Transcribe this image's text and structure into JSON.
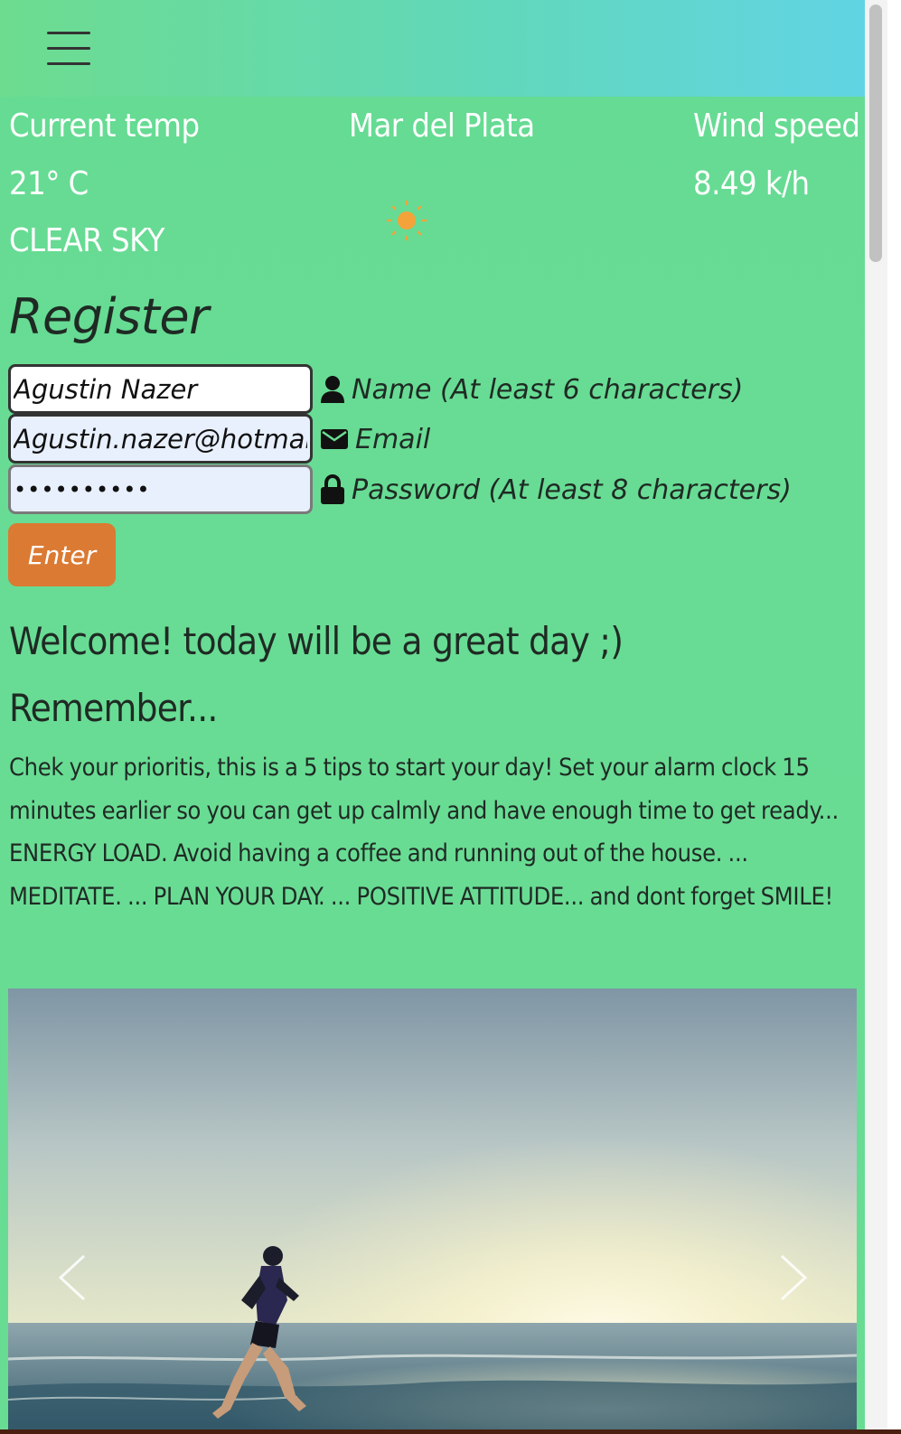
{
  "header": {
    "menu_icon": "hamburger-menu-icon"
  },
  "weather": {
    "current_temp_label": "Current temp",
    "temperature": "21° C",
    "condition": "CLEAR SKY",
    "city": "Mar del Plata",
    "weather_icon": "sun-icon",
    "wind_label": "Wind speed",
    "wind_value": "8.49 k/h"
  },
  "register": {
    "title": "Register",
    "name_value": "Agustin Nazer",
    "name_label": "Name (At least 6 characters)",
    "email_value": "Agustin.nazer@hotmail.com",
    "email_label": "Email",
    "password_value": "••••••••••",
    "password_label": "Password (At least 8 characters)",
    "enter_label": "Enter"
  },
  "content": {
    "welcome": "Welcome! today will be a great day ;)",
    "remember": "Remember...",
    "tips": "Chek your prioritis, this is a 5 tips to start your day! Set your alarm clock 15 minutes earlier so you can get up calmly and have enough time to get ready... ENERGY LOAD. Avoid having a coffee and running out of the house. ... MEDITATE. ... PLAN YOUR DAY. ... POSITIVE ATTITUDE... and dont forget SMILE!"
  },
  "carousel": {
    "image_subject": "man running on the beach at sunrise",
    "prev_icon": "chevron-left-icon",
    "next_icon": "chevron-right-icon"
  },
  "colors": {
    "background": "#6adc92",
    "header_gradient_start": "#6ddc8f",
    "header_gradient_end": "#61d4e4",
    "button": "#db7a33",
    "sun": "#f3a33a"
  }
}
